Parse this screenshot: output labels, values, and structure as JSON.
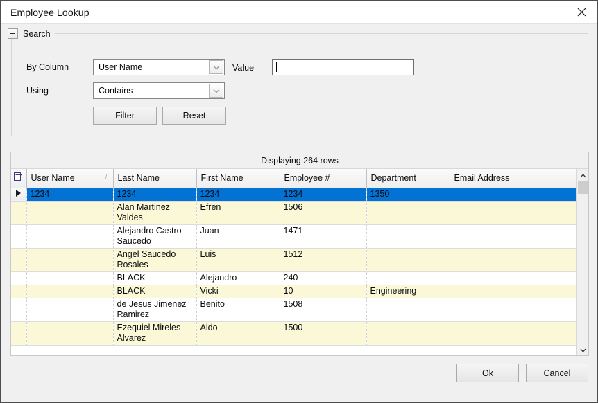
{
  "window": {
    "title": "Employee Lookup",
    "close_icon": "close-icon"
  },
  "search_panel": {
    "legend": "Search",
    "collapse_icon": "minus-icon",
    "by_column_label": "By Column",
    "by_column_value": "User Name",
    "using_label": "Using",
    "using_value": "Contains",
    "value_label": "Value",
    "value_text": "",
    "value_placeholder": "",
    "filter_button": "Filter",
    "reset_button": "Reset",
    "dropdown_icon": "chevron-down-icon"
  },
  "grid": {
    "status": "Displaying 264 rows",
    "corner_icon": "select-all-icon",
    "sort_indicator": "/",
    "columns": [
      "User Name",
      "Last Name",
      "First Name",
      "Employee #",
      "Department",
      "Email Address"
    ],
    "rows": [
      {
        "selected": true,
        "user_name": "1234",
        "last_name": "1234",
        "first_name": "1234",
        "employee_no": "1234",
        "department": "1350",
        "email": ""
      },
      {
        "selected": false,
        "user_name": "",
        "last_name": "Alan Martinez Valdes",
        "first_name": "Efren",
        "employee_no": "1506",
        "department": "",
        "email": ""
      },
      {
        "selected": false,
        "user_name": "",
        "last_name": "Alejandro Castro Saucedo",
        "first_name": "Juan",
        "employee_no": "1471",
        "department": "",
        "email": ""
      },
      {
        "selected": false,
        "user_name": "",
        "last_name": "Angel Saucedo Rosales",
        "first_name": "Luis",
        "employee_no": "1512",
        "department": "",
        "email": ""
      },
      {
        "selected": false,
        "user_name": "",
        "last_name": "BLACK",
        "first_name": "Alejandro",
        "employee_no": "240",
        "department": "",
        "email": ""
      },
      {
        "selected": false,
        "user_name": "",
        "last_name": "BLACK",
        "first_name": "Vicki",
        "employee_no": "10",
        "department": "Engineering",
        "email": ""
      },
      {
        "selected": false,
        "user_name": "",
        "last_name": "de Jesus Jimenez Ramirez",
        "first_name": "Benito",
        "employee_no": "1508",
        "department": "",
        "email": ""
      },
      {
        "selected": false,
        "user_name": "",
        "last_name": "Ezequiel Mireles Alvarez",
        "first_name": "Aldo",
        "employee_no": "1500",
        "department": "",
        "email": ""
      }
    ],
    "scrollbar": {
      "up_icon": "chevron-up-icon",
      "down_icon": "chevron-down-icon"
    }
  },
  "footer": {
    "ok_button": "Ok",
    "cancel_button": "Cancel"
  },
  "colors": {
    "selection": "#0272d4",
    "alt_row": "#fbf8d8",
    "window_bg": "#f0f0f0"
  }
}
